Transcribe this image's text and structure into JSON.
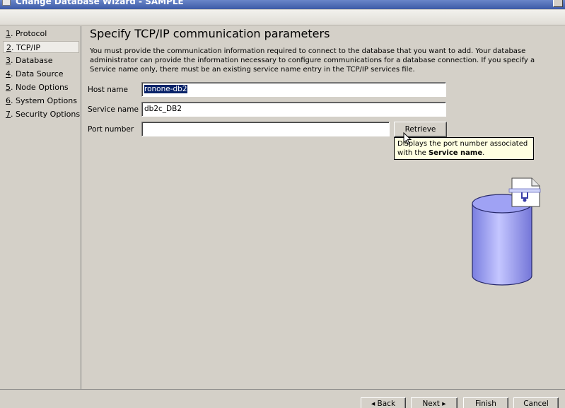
{
  "window": {
    "title": "Change Database Wizard - SAMPLE"
  },
  "nav": {
    "items": [
      {
        "num": "1",
        "label": ". Protocol"
      },
      {
        "num": "2",
        "label": ". TCP/IP"
      },
      {
        "num": "3",
        "label": ". Database"
      },
      {
        "num": "4",
        "label": ". Data Source"
      },
      {
        "num": "5",
        "label": ". Node Options"
      },
      {
        "num": "6",
        "label": ". System Options"
      },
      {
        "num": "7",
        "label": ". Security Options"
      }
    ],
    "selected_index": 1
  },
  "page": {
    "title": "Specify TCP/IP communication parameters",
    "description": "You must provide the communication information required to connect to the database that you want to add. Your database administrator can provide the information necessary to configure communications for a database connection. If you specify a Service name only, there must be an existing service name entry in the TCP/IP services file."
  },
  "form": {
    "host_name": {
      "label": "Host name",
      "value": "ronone-db2"
    },
    "service_name": {
      "label": "Service name",
      "value": "db2c_DB2"
    },
    "port_number": {
      "label": "Port number",
      "value": ""
    },
    "retrieve_button": "Retrieve"
  },
  "tooltip": {
    "line1": "Displays the port number associated",
    "line2_prefix": "with the ",
    "line2_bold": "Service name",
    "line2_suffix": "."
  },
  "footer": {
    "back": "◂ Back",
    "next": "Next ▸",
    "finish": "Finish",
    "cancel": "Cancel"
  },
  "icons": [
    "window-icon",
    "close-icon",
    "database-icon",
    "config-file-icon",
    "mouse-cursor-icon"
  ]
}
